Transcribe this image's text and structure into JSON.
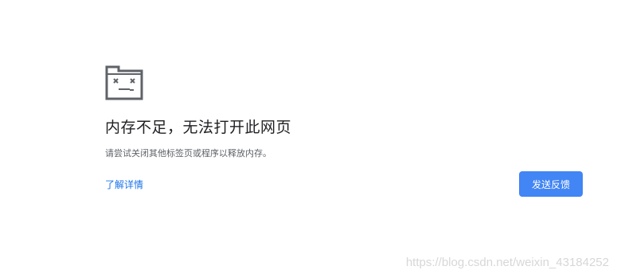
{
  "error_page": {
    "icon": "sad-folder-icon",
    "title": "内存不足，无法打开此网页",
    "message": "请尝试关闭其他标签页或程序以释放内存。",
    "details_link": "了解详情",
    "feedback_button": "发送反馈"
  },
  "watermark": {
    "text": "https://blog.csdn.net/weixin_43184252"
  },
  "colors": {
    "accent": "#4285f4",
    "link": "#1a73e8",
    "icon_gray": "#5f6368",
    "title": "#202124"
  }
}
